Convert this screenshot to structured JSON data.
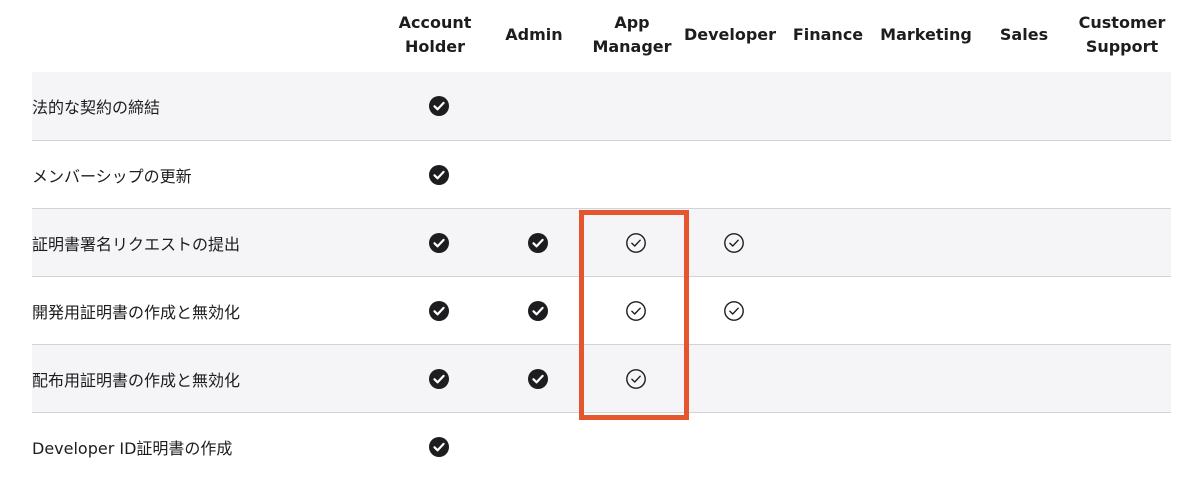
{
  "columns": [
    {
      "id": "account_holder",
      "label": "Account\nHolder"
    },
    {
      "id": "admin",
      "label": "Admin"
    },
    {
      "id": "app_manager",
      "label": "App\nManager"
    },
    {
      "id": "developer",
      "label": "Developer"
    },
    {
      "id": "finance",
      "label": "Finance"
    },
    {
      "id": "marketing",
      "label": "Marketing"
    },
    {
      "id": "sales",
      "label": "Sales"
    },
    {
      "id": "customer_support",
      "label": "Customer\nSupport"
    }
  ],
  "rows": [
    {
      "label": "法的な契約の締結",
      "permissions": [
        "full",
        null,
        null,
        null,
        null,
        null,
        null,
        null
      ]
    },
    {
      "label": "メンバーシップの更新",
      "permissions": [
        "full",
        null,
        null,
        null,
        null,
        null,
        null,
        null
      ]
    },
    {
      "label": "証明書署名リクエストの提出",
      "permissions": [
        "full",
        "full",
        "partial",
        "partial",
        null,
        null,
        null,
        null
      ]
    },
    {
      "label": "開発用証明書の作成と無効化",
      "permissions": [
        "full",
        "full",
        "partial",
        "partial",
        null,
        null,
        null,
        null
      ]
    },
    {
      "label": "配布用証明書の作成と無効化",
      "permissions": [
        "full",
        "full",
        "partial",
        null,
        null,
        null,
        null,
        null
      ]
    },
    {
      "label": "Developer ID証明書の作成",
      "permissions": [
        "full",
        null,
        null,
        null,
        null,
        null,
        null,
        null
      ]
    }
  ],
  "highlight": {
    "column": "app_manager",
    "color": "#e4572e"
  },
  "icons": {
    "full": "filled-check-circle-icon",
    "partial": "outline-check-circle-icon"
  },
  "colors": {
    "text": "#1d1d1f",
    "row_shade": "#f5f5f7",
    "divider": "#d2d2d7",
    "highlight": "#e4572e"
  }
}
